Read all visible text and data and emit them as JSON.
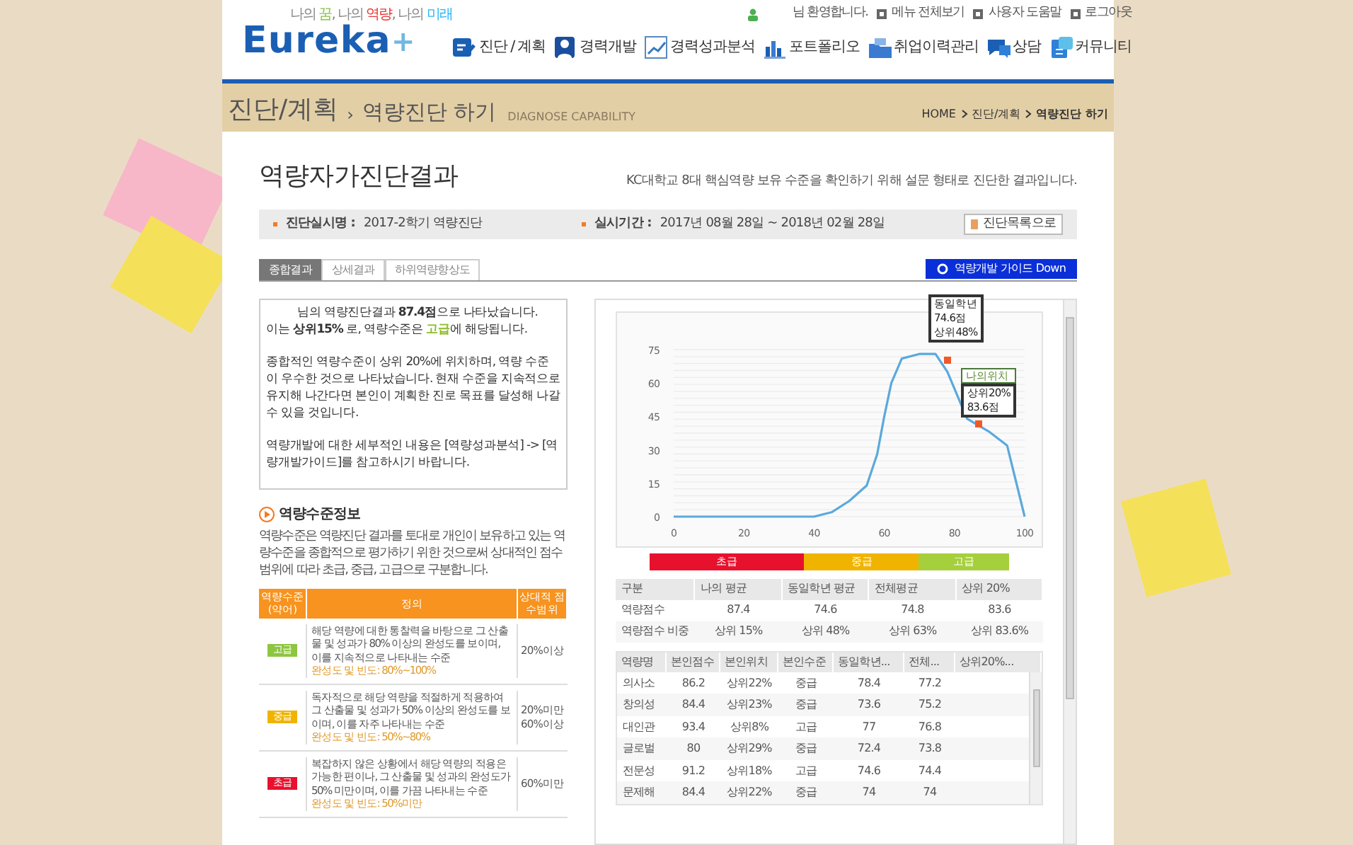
{
  "header": {
    "logo": "Eureka",
    "logo_plus": "+",
    "tagline": [
      {
        "text": "나의 ",
        "color": "#888888"
      },
      {
        "text": "꿈",
        "color": "#8bc34a"
      },
      {
        "text": ", 나의 ",
        "color": "#888888"
      },
      {
        "text": "역량",
        "color": "#e53935"
      },
      {
        "text": ", 나의 ",
        "color": "#888888"
      },
      {
        "text": "미래",
        "color": "#29b6f6"
      }
    ],
    "welcome": "님 환영합니다.",
    "links": [
      "메뉴 전체보기",
      "사용자 도움말",
      "로그아웃"
    ],
    "nav": [
      "진단 / 계획",
      "경력개발",
      "경력성과분석",
      "포트폴리오",
      "취업이력관리",
      "상담",
      "커뮤니티"
    ]
  },
  "page_title": {
    "section": "진단/계획",
    "separator": "›",
    "page": "역량진단 하기",
    "english": "DIAGNOSE CAPABILITY",
    "breadcrumb": [
      "HOME",
      "진단/계획",
      "역량진단 하기"
    ]
  },
  "heading": "역량자가진단결과",
  "description": "KC대학교 8대 핵심역량 보유 수준을 확인하기 위해 설문 형태로 진단한 결과입니다.",
  "info": [
    {
      "label": "진단실시명 :",
      "value": "2017-2학기 역량진단"
    },
    {
      "label": "실시기간 :",
      "value": "2017년 08월 28일 ~ 2018년 02월 28일"
    }
  ],
  "list_button": "진단목록으로",
  "tabs": [
    {
      "label": "종합결과",
      "selected": true
    },
    {
      "label": "상세결과",
      "selected": false
    },
    {
      "label": "하위역량향상도",
      "selected": false
    }
  ],
  "guide_button": "역량개발 가이드 Down",
  "summary": {
    "line1": "님의 역량진단결과 **87.4점**으로 나타났습니다.",
    "line2_before": "이는 **상위15%** 로, 역량수준은 ",
    "line2_level": "고급",
    "line2_after": "에 해당됩니다.",
    "paragraphs": [
      "종합적인 역량수준이 상위 20%에 위치하며, 역량 수준이 우수한 것으로 나타났습니다. 현재 수준을 지속적으로 유지해 나간다면 본인이 계획한 진로 목표를 달성해 나갈 수 있을 것입니다.",
      "역량개발에 대한 세부적인 내용은 [역량성과분석] -> [역량개발가이드]를 참고하시기 바랍니다."
    ]
  },
  "level_info": {
    "title": "역량수준정보",
    "text": "역량수준은 역량진단 결과를 토대로 개인이 보유하고 있는 역량수준을 종합적으로 평가하기 위한 것으로써 상대적인 점수범위에 따라 초급, 중급, 고급으로 구분합니다.",
    "columns": [
      "역량수준(약어)",
      "정의",
      "상대적 점수범위"
    ],
    "rows": [
      {
        "badge": "고급",
        "color": "#8dc63f",
        "definition": "해당 역량에 대한 통찰력을 바탕으로 그 산출물 및 성과가 80% 이상의 완성도를 보이며, 이를 지속적으로 나타내는 수준",
        "frequency": "완성도 및 빈도: 80%~100%",
        "range": [
          "20%이상"
        ]
      },
      {
        "badge": "중급",
        "color": "#f0b400",
        "definition": "독자적으로 해당 역량을 적절하게 적용하여 그 산출물 및 성과가 50% 이상의 완성도를 보이며, 이를 자주 나타내는 수준",
        "frequency": "완성도 및 빈도: 50%~80%",
        "range": [
          "20%미만",
          "60%이상"
        ]
      },
      {
        "badge": "초급",
        "color": "#e8112d",
        "definition": "복잡하지 않은 상황에서 해당 역량의 적용은 가능한 편이나, 그 산출물 및 성과의 완성도가 50% 미만이며, 이를 가끔 나타내는 수준",
        "frequency": "완성도 및 빈도: 50%미만",
        "range": [
          "60%미만"
        ]
      }
    ]
  },
  "chart_data": {
    "type": "line",
    "x": [
      0,
      10,
      20,
      30,
      40,
      45,
      50,
      55,
      58,
      60,
      62,
      65,
      70,
      74.6,
      78,
      83.6,
      90,
      95,
      100
    ],
    "series": [
      {
        "color": "#5aa9dc",
        "values": [
          0,
          0,
          0,
          0,
          0,
          2,
          7,
          14,
          28,
          45,
          60,
          71,
          73,
          73,
          65,
          44,
          38,
          32,
          0
        ]
      }
    ],
    "xlim": [
      0,
      100
    ],
    "ylim": [
      0,
      75
    ],
    "xticks": [
      0,
      20,
      40,
      60,
      80,
      100
    ],
    "yticks": [
      0,
      15,
      30,
      45,
      60,
      75
    ]
  },
  "chart_callouts": [
    {
      "lines": [
        "동일학년",
        "74.6점",
        "상위48%"
      ]
    },
    {
      "title": "나의위치",
      "lines": [
        "상위20%",
        "83.6점"
      ]
    }
  ],
  "bands": [
    {
      "label": "초급",
      "color": "#e8112d"
    },
    {
      "label": "중급",
      "color": "#f0b400"
    },
    {
      "label": "고급",
      "color": "#a6cf3c"
    }
  ],
  "summary_table": {
    "columns": [
      "구분",
      "나의 평균",
      "동일학년 평균",
      "전체평균",
      "상위 20%"
    ],
    "rows": [
      [
        "역량점수",
        "87.4",
        "74.6",
        "74.8",
        "83.6"
      ],
      [
        "역량점수 비중",
        "상위 15%",
        "상위 48%",
        "상위 63%",
        "상위 83.6%"
      ]
    ]
  },
  "detail_table": {
    "columns": [
      "역량명",
      "본인점수",
      "본인위치",
      "본인수준",
      "동일학년...",
      "전체...",
      "상위20%..."
    ],
    "rows": [
      [
        "의사소",
        "86.2",
        "상위22%",
        "중급",
        "78.4",
        "77.2"
      ],
      [
        "창의성",
        "84.4",
        "상위23%",
        "중급",
        "73.6",
        "75.2"
      ],
      [
        "대인관",
        "93.4",
        "상위8%",
        "고급",
        "77",
        "76.8"
      ],
      [
        "글로벌",
        "80",
        "상위29%",
        "중급",
        "72.4",
        "73.8"
      ],
      [
        "전문성",
        "91.2",
        "상위18%",
        "고급",
        "74.6",
        "74.4"
      ],
      [
        "문제해",
        "84.4",
        "상위22%",
        "중급",
        "74",
        "74"
      ]
    ]
  }
}
